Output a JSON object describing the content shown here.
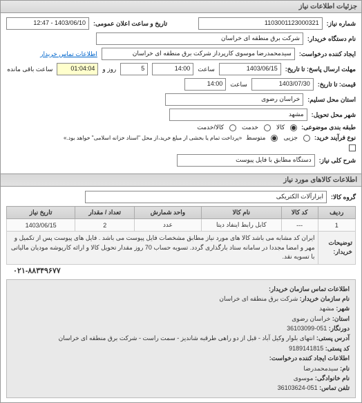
{
  "panel": {
    "title": "جزئیات اطلاعات نیاز"
  },
  "header": {
    "request_no_label": "شماره نیاز:",
    "request_no": "1103001123000321",
    "announce_label": "تاریخ و ساعت اعلان عمومی:",
    "announce_value": "1403/06/10 - 12:47",
    "buyer_org_label": "نام دستگاه خریدار:",
    "buyer_org": "شرکت برق منطقه ای خراسان",
    "creator_label": "ایجاد کننده درخواست:",
    "creator": "سیدمحمدرضا موسوی کارپرداز شرکت برق منطقه ای خراسان",
    "buyer_contact_link": "اطلاعات تماس خریدار",
    "deadline_label": "مهلت ارسال پاسخ: تا تاریخ:",
    "deadline_date": "1403/06/15",
    "time_label": "ساعت",
    "deadline_time": "14:00",
    "days_remaining": "5",
    "days_remaining_label": "روز و",
    "time_remaining": "01:04:04",
    "time_remaining_label": "ساعت باقی مانده",
    "price_validity_label": "قیمت: تا تاریخ:",
    "price_validity_date": "1403/07/30",
    "price_validity_time": "14:00",
    "province_label": "استان محل تسلیم:",
    "province": "خراسان رضوی",
    "city_label": "شهر محل تحویل:",
    "city": "مشهد",
    "category_label": "طبقه بندی موضوعی:",
    "cat_options": {
      "goods": "کالا",
      "service": "خدمت",
      "goods_service": "کالا/خدمت"
    },
    "process_type_label": "نوع فرآیند خرید:",
    "proc_options": {
      "small": "جزیی",
      "medium": "متوسط"
    },
    "process_note": "«پرداخت تمام یا بخشی از مبلغ خرید،از محل \"اسناد خزانه اسلامی\" خواهد بود.»",
    "desc_label": "شرح کلی نیاز:",
    "desc_value": "دستگاه مطابق با فایل پیوست"
  },
  "items_section": {
    "title": "اطلاعات کالاهای مورد نیاز",
    "group_label": "گروه کالا:",
    "group_value": "ابزارآلات الکتریکی"
  },
  "table": {
    "headers": {
      "row": "ردیف",
      "code": "کد کالا",
      "name": "نام کالا",
      "unit": "واحد شمارش",
      "qty": "تعداد / مقدار",
      "date": "تاریخ نیاز"
    },
    "rows": [
      {
        "row": "1",
        "code": "---",
        "name": "کابل رابط اینفاد دیتا",
        "unit": "عدد",
        "qty": "2",
        "date": "1403/06/15"
      }
    ],
    "notes_label": "توضیحات خریدار:",
    "notes_text": "ایران کد مشابه می باشد کالا های مورد نیاز مطابق مشخصات فایل پیوست می باشد . فایل های پیوست پس از تکمیل و مهر و امضا مجددا در سامانه ستاد بارگذاری گردد. تسویه حساب 70 روز مقدار تحویل کالا و ارائه کارپوشه مودیان مالیاتی با تسویه نقد."
  },
  "contact": {
    "title": "اطلاعات تماس سازمان خریدار:",
    "org_label": "نام سازمان خریدار:",
    "org": "شرکت برق منطقه ای خراسان",
    "city_label": "شهر:",
    "city": "مشهد",
    "province_label": "استان:",
    "province": "خراسان رضوی",
    "fax_label": "دورنگار:",
    "fax": "051-36103099",
    "address_label": "آدرس پستی:",
    "address": "انتهای بلوار وکیل آباد - قبل از دو راهی طرقبه شاندیز - سمت راست - شرکت برق منطقه ای خراسان",
    "postal_label": "کد پستی:",
    "postal": "9189141815",
    "creator_title": "اطلاعات ایجاد کننده درخواست:",
    "name_label": "نام:",
    "name": "سیدمحمدرضا",
    "lastname_label": "نام خانوادگی:",
    "lastname": "موسوی",
    "phone_label": "تلفن تماس:",
    "phone": "051-36103624"
  },
  "footer": {
    "phone": "۰۲۱-۸۸۳۴۹۶۷۷"
  }
}
